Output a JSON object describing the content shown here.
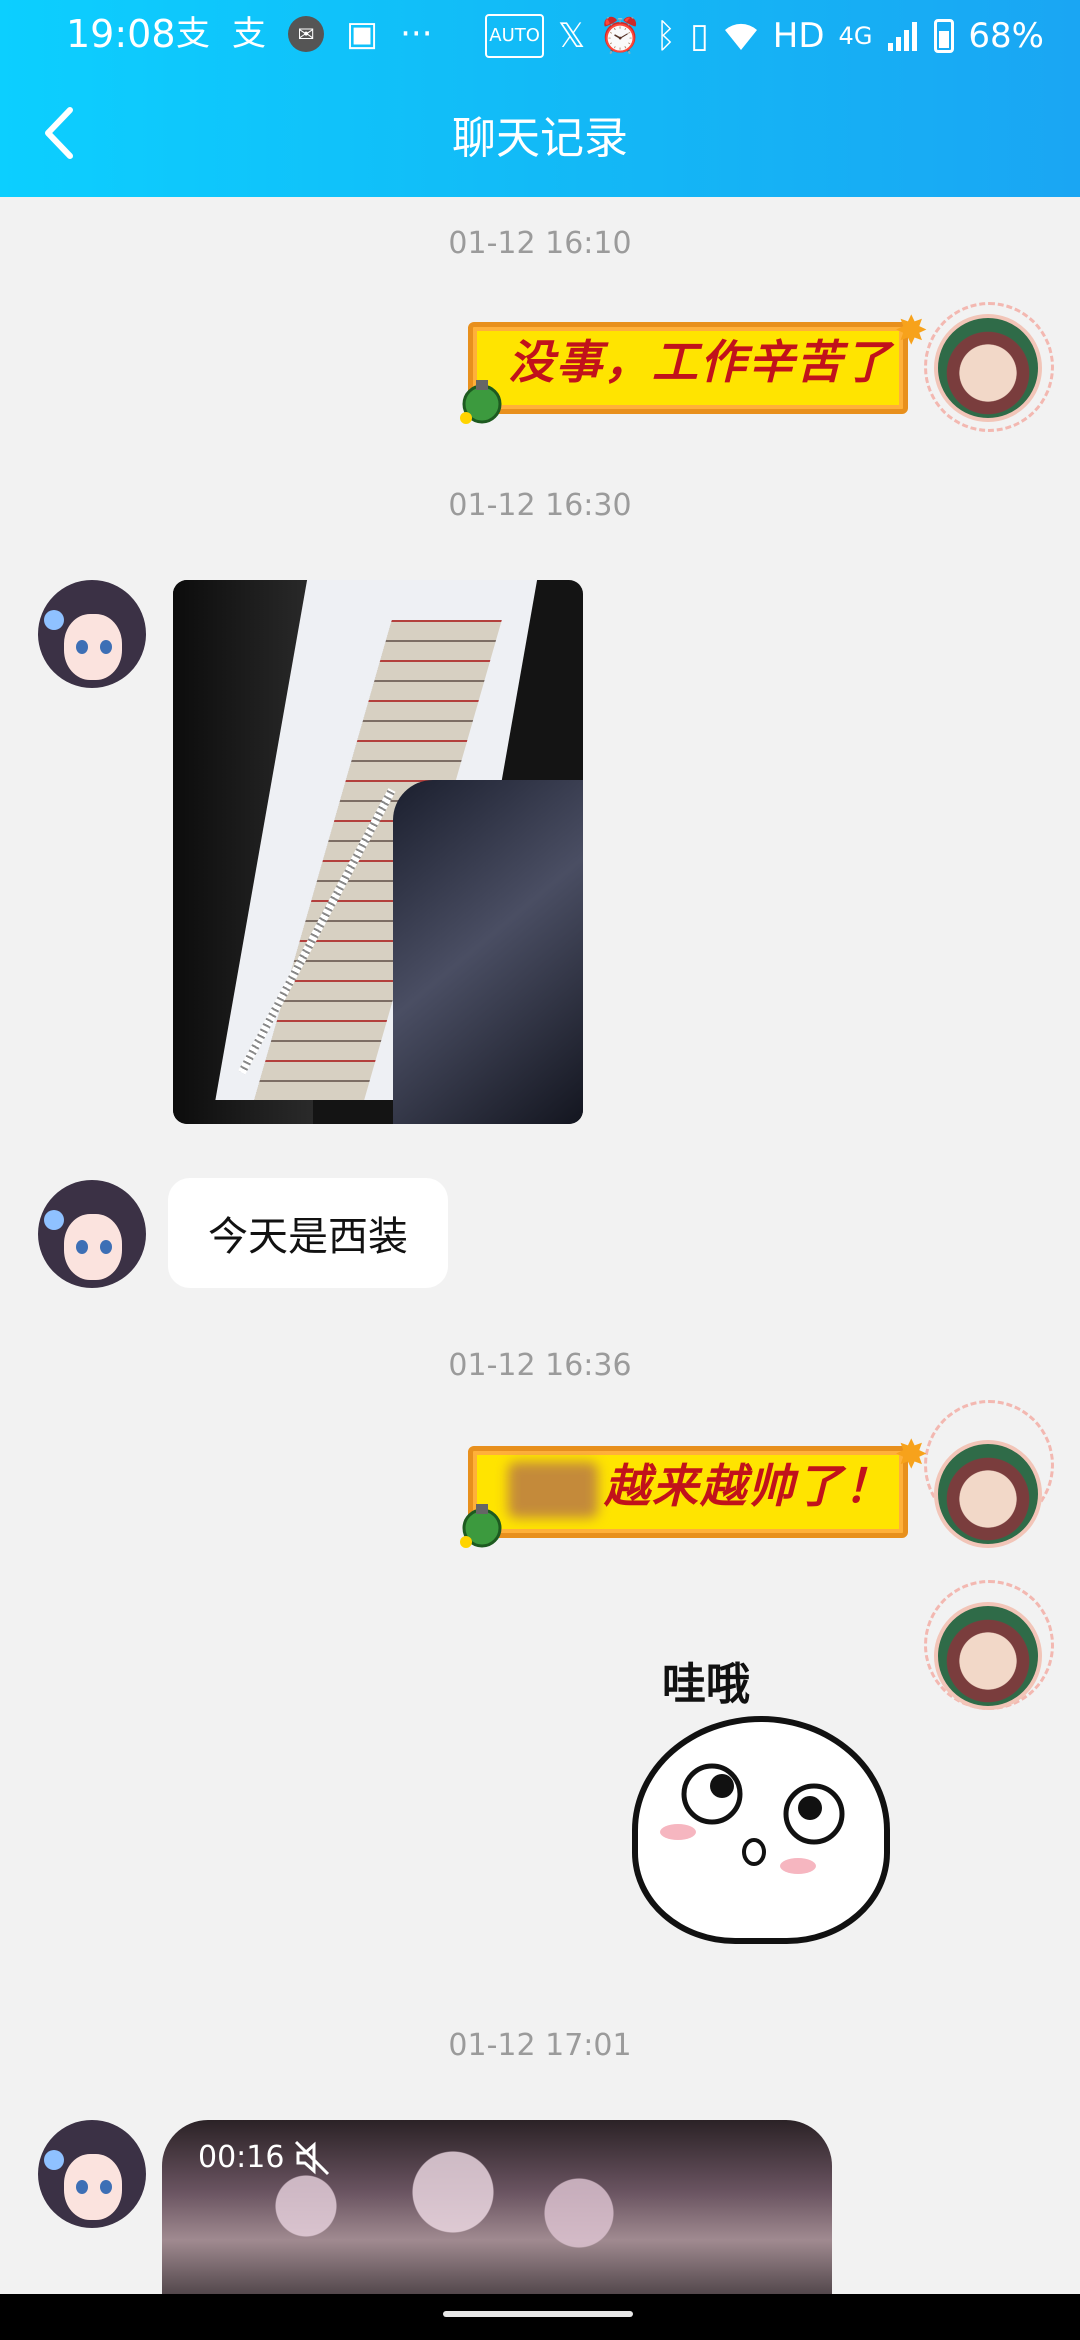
{
  "status_bar": {
    "time": "19:08",
    "left_icons": [
      "alipay-icon",
      "alipay-icon",
      "mail-notification-icon",
      "gallery-icon",
      "more-dots-icon"
    ],
    "right_icons": [
      "auto-hz-icon",
      "x-icon",
      "alarm-icon",
      "bluetooth-icon",
      "vibrate-icon",
      "wifi-icon",
      "hd-icon",
      "4g-icon",
      "signal-icon",
      "battery-icon"
    ],
    "hd_text": "HD",
    "net_text": "4G",
    "battery": "68%"
  },
  "header": {
    "title": "聊天记录"
  },
  "messages": {
    "ts1": "01-12 16:10",
    "banner1": "没事，工作辛苦了",
    "ts2": "01-12 16:30",
    "text1": "今天是西装",
    "ts3": "01-12 16:36",
    "banner2": "越来越帅了！",
    "sticker_label": "哇哦",
    "ts4": "01-12 17:01",
    "video_duration": "00:16"
  },
  "colors": {
    "header_start": "#0ccfff",
    "header_end": "#1aa6f3",
    "background": "#f2f2f2",
    "banner_yellow": "#ffe400",
    "banner_text": "#c1121b"
  }
}
